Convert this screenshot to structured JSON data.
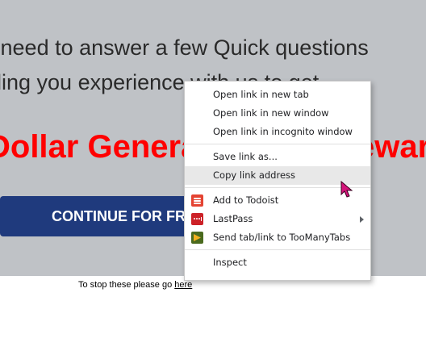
{
  "page": {
    "question_line1": "u need to answer a few Quick questions",
    "question_line2": "rding you experience with us to get",
    "headline": "Dollar General Survey Reward",
    "cta_label": "CONTINUE FOR FREE",
    "stop_text": "To stop these please go ",
    "stop_link": "here"
  },
  "context_menu": {
    "group1": [
      "Open link in new tab",
      "Open link in new window",
      "Open link in incognito window"
    ],
    "save_link": "Save link as...",
    "copy_link": "Copy link address",
    "todoist": "Add to Todoist",
    "lastpass": "LastPass",
    "toomanytabs": "Send tab/link to TooManyTabs",
    "inspect": "Inspect"
  },
  "colors": {
    "banner_bg": "#bfc2c6",
    "headline": "#ff0000",
    "cta_bg": "#1f3a7d",
    "cursor": "#d4147a"
  }
}
